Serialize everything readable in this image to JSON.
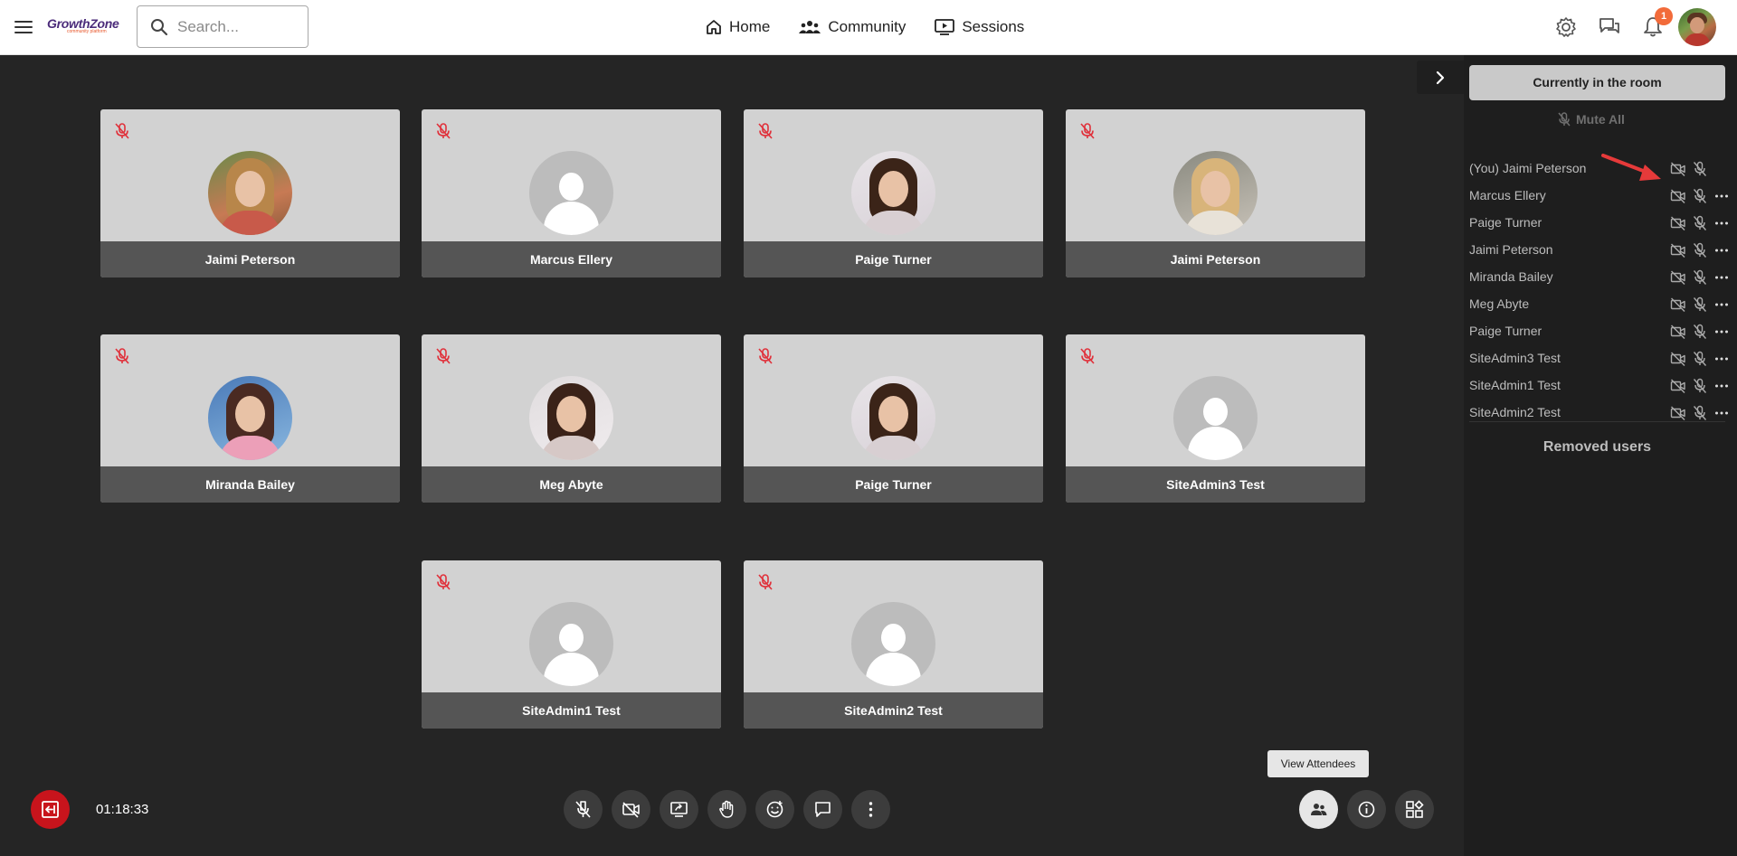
{
  "header": {
    "logo_text": "GrowthZone",
    "logo_subtext": "community platform",
    "search_placeholder": "Search...",
    "nav": [
      {
        "label": "Home",
        "icon": "home-icon"
      },
      {
        "label": "Community",
        "icon": "community-icon"
      },
      {
        "label": "Sessions",
        "icon": "sessions-icon"
      }
    ],
    "notification_count": "1"
  },
  "tiles": [
    {
      "name": "Jaimi Peterson",
      "avatar": "photo"
    },
    {
      "name": "Marcus Ellery",
      "avatar": "placeholder"
    },
    {
      "name": "Paige Turner",
      "avatar": "photo"
    },
    {
      "name": "Jaimi Peterson",
      "avatar": "photo"
    },
    {
      "name": "Miranda Bailey",
      "avatar": "photo"
    },
    {
      "name": "Meg Abyte",
      "avatar": "photo"
    },
    {
      "name": "Paige Turner",
      "avatar": "photo"
    },
    {
      "name": "SiteAdmin3 Test",
      "avatar": "placeholder"
    },
    {
      "name": "SiteAdmin1 Test",
      "avatar": "placeholder"
    },
    {
      "name": "SiteAdmin2 Test",
      "avatar": "placeholder"
    }
  ],
  "controls": {
    "timer": "01:18:33",
    "tooltip": "View Attendees",
    "buttons": [
      "mic-off-icon",
      "camera-off-icon",
      "screen-share-icon",
      "raise-hand-icon",
      "emoji-icon",
      "chat-icon",
      "more-vertical-icon"
    ],
    "right_buttons": [
      "attendees-icon",
      "info-icon",
      "layout-icon"
    ]
  },
  "panel": {
    "header": "Currently in the room",
    "mute_all": "Mute All",
    "attendees": [
      {
        "name": "(You) Jaimi Peterson",
        "has_more": false
      },
      {
        "name": "Marcus Ellery",
        "has_more": true
      },
      {
        "name": "Paige Turner",
        "has_more": true
      },
      {
        "name": "Jaimi Peterson",
        "has_more": true
      },
      {
        "name": "Miranda Bailey",
        "has_more": true
      },
      {
        "name": "Meg Abyte",
        "has_more": true
      },
      {
        "name": "Paige Turner",
        "has_more": true
      },
      {
        "name": "SiteAdmin3 Test",
        "has_more": true
      },
      {
        "name": "SiteAdmin1 Test",
        "has_more": true
      },
      {
        "name": "SiteAdmin2 Test",
        "has_more": true
      }
    ],
    "removed_label": "Removed users"
  },
  "colors": {
    "accent_red": "#c8141c",
    "mic_muted_red": "#e0303a",
    "brand_purple": "#4b2b7a",
    "brand_orange": "#e8562a",
    "badge_orange": "#f26b3a"
  }
}
